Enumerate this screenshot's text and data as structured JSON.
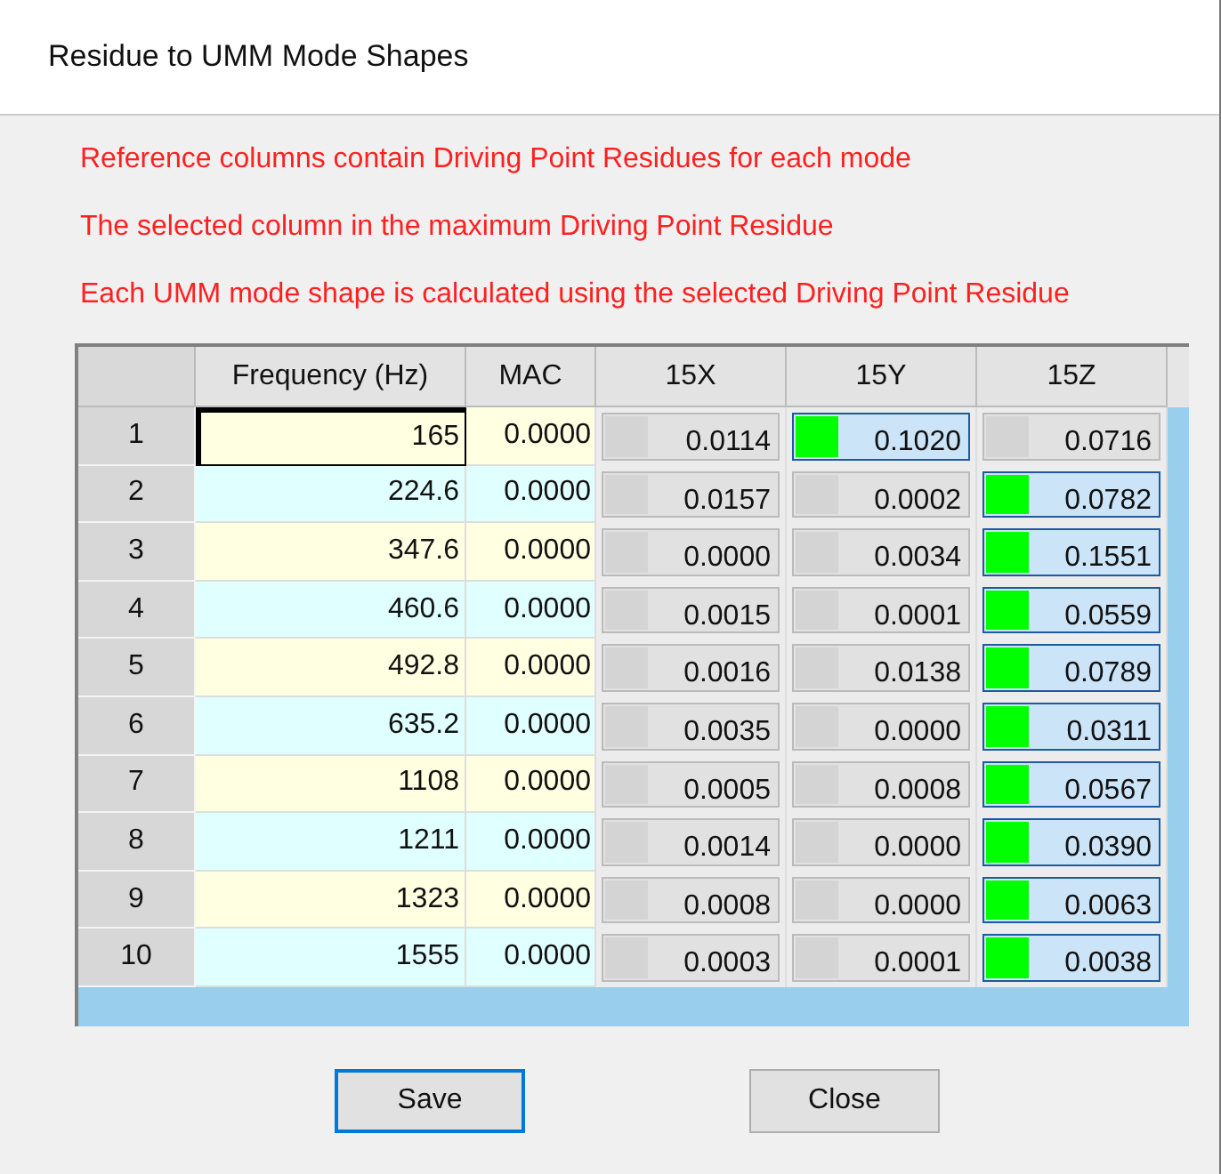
{
  "window": {
    "title": "Residue to UMM Mode Shapes"
  },
  "notes": [
    "Reference columns contain Driving Point Residues for each mode",
    "The selected column in the maximum Driving Point Residue",
    "Each UMM mode shape is calculated using the selected Driving Point Residue"
  ],
  "table": {
    "columns": [
      "Frequency (Hz)",
      "MAC",
      "15X",
      "15Y",
      "15Z"
    ],
    "rows": [
      {
        "index": "1",
        "frequency": "165",
        "focused": true,
        "mac": "0.0000",
        "residues": [
          {
            "value": "0.0114",
            "selected": false
          },
          {
            "value": "0.1020",
            "selected": true
          },
          {
            "value": "0.0716",
            "selected": false
          }
        ]
      },
      {
        "index": "2",
        "frequency": "224.6",
        "focused": false,
        "mac": "0.0000",
        "residues": [
          {
            "value": "0.0157",
            "selected": false
          },
          {
            "value": "0.0002",
            "selected": false
          },
          {
            "value": "0.0782",
            "selected": true
          }
        ]
      },
      {
        "index": "3",
        "frequency": "347.6",
        "focused": false,
        "mac": "0.0000",
        "residues": [
          {
            "value": "0.0000",
            "selected": false
          },
          {
            "value": "0.0034",
            "selected": false
          },
          {
            "value": "0.1551",
            "selected": true
          }
        ]
      },
      {
        "index": "4",
        "frequency": "460.6",
        "focused": false,
        "mac": "0.0000",
        "residues": [
          {
            "value": "0.0015",
            "selected": false
          },
          {
            "value": "0.0001",
            "selected": false
          },
          {
            "value": "0.0559",
            "selected": true
          }
        ]
      },
      {
        "index": "5",
        "frequency": "492.8",
        "focused": false,
        "mac": "0.0000",
        "residues": [
          {
            "value": "0.0016",
            "selected": false
          },
          {
            "value": "0.0138",
            "selected": false
          },
          {
            "value": "0.0789",
            "selected": true
          }
        ]
      },
      {
        "index": "6",
        "frequency": "635.2",
        "focused": false,
        "mac": "0.0000",
        "residues": [
          {
            "value": "0.0035",
            "selected": false
          },
          {
            "value": "0.0000",
            "selected": false
          },
          {
            "value": "0.0311",
            "selected": true
          }
        ]
      },
      {
        "index": "7",
        "frequency": "1108",
        "focused": false,
        "mac": "0.0000",
        "residues": [
          {
            "value": "0.0005",
            "selected": false
          },
          {
            "value": "0.0008",
            "selected": false
          },
          {
            "value": "0.0567",
            "selected": true
          }
        ]
      },
      {
        "index": "8",
        "frequency": "1211",
        "focused": false,
        "mac": "0.0000",
        "residues": [
          {
            "value": "0.0014",
            "selected": false
          },
          {
            "value": "0.0000",
            "selected": false
          },
          {
            "value": "0.0390",
            "selected": true
          }
        ]
      },
      {
        "index": "9",
        "frequency": "1323",
        "focused": false,
        "mac": "0.0000",
        "residues": [
          {
            "value": "0.0008",
            "selected": false
          },
          {
            "value": "0.0000",
            "selected": false
          },
          {
            "value": "0.0063",
            "selected": true
          }
        ]
      },
      {
        "index": "10",
        "frequency": "1555",
        "focused": false,
        "mac": "0.0000",
        "residues": [
          {
            "value": "0.0003",
            "selected": false
          },
          {
            "value": "0.0001",
            "selected": false
          },
          {
            "value": "0.0038",
            "selected": true
          }
        ]
      }
    ]
  },
  "buttons": [
    {
      "label": "Save",
      "default": true
    },
    {
      "label": "Close",
      "default": false
    }
  ]
}
